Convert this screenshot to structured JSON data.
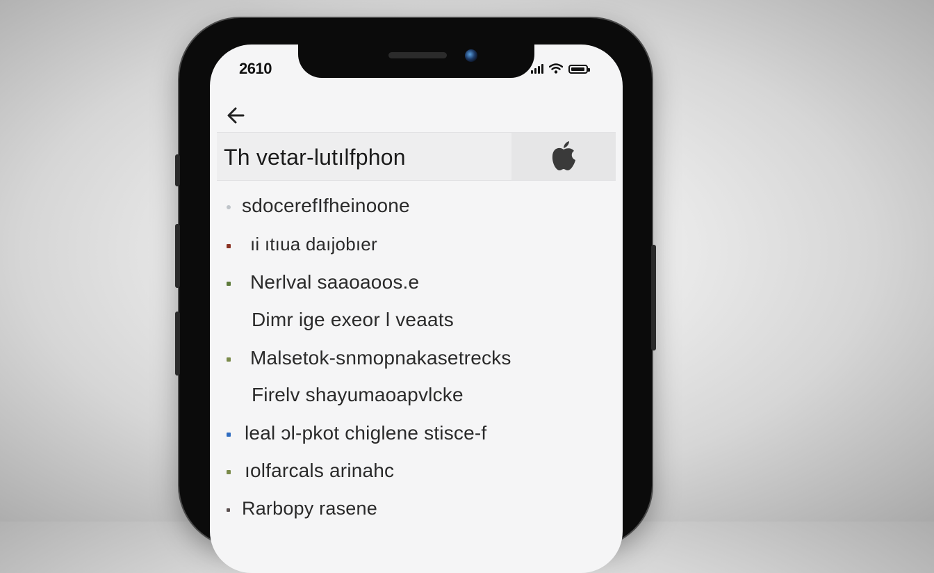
{
  "status_bar": {
    "time": "2610"
  },
  "header": {
    "title": "Th vetar-lutılfphon"
  },
  "list": {
    "items": [
      {
        "text": "sdocerefIfheinoone",
        "bullet_color": "#bfc4c9"
      },
      {
        "text": "ıi ıtıua daıjobıer",
        "bullet_color": "#8a3324"
      },
      {
        "text": "Nerlval saaoaoos.e",
        "bullet_color": "#5d7a3a"
      },
      {
        "text": "Dimr ige exeor l veaats",
        "bullet_color": ""
      },
      {
        "text": "Malsetok-snmopnakasetrecks",
        "bullet_color": "#7a8a4a"
      },
      {
        "text": "Firelv shayumaoapvlcke",
        "bullet_color": ""
      },
      {
        "text": "leal ɔl-pkot chiglene stisce-f",
        "bullet_color": "#2f6cc0"
      },
      {
        "text": "ıolfarcals arinahc",
        "bullet_color": "#7a8a4a"
      },
      {
        "text": "Rarbopy rasene",
        "bullet_color": "#5a4f4f"
      }
    ]
  },
  "icons": {
    "back": "arrow-left-icon",
    "logo": "apple-logo-icon",
    "signal": "cellular-signal-icon",
    "wifi": "wifi-icon",
    "battery": "battery-icon"
  }
}
